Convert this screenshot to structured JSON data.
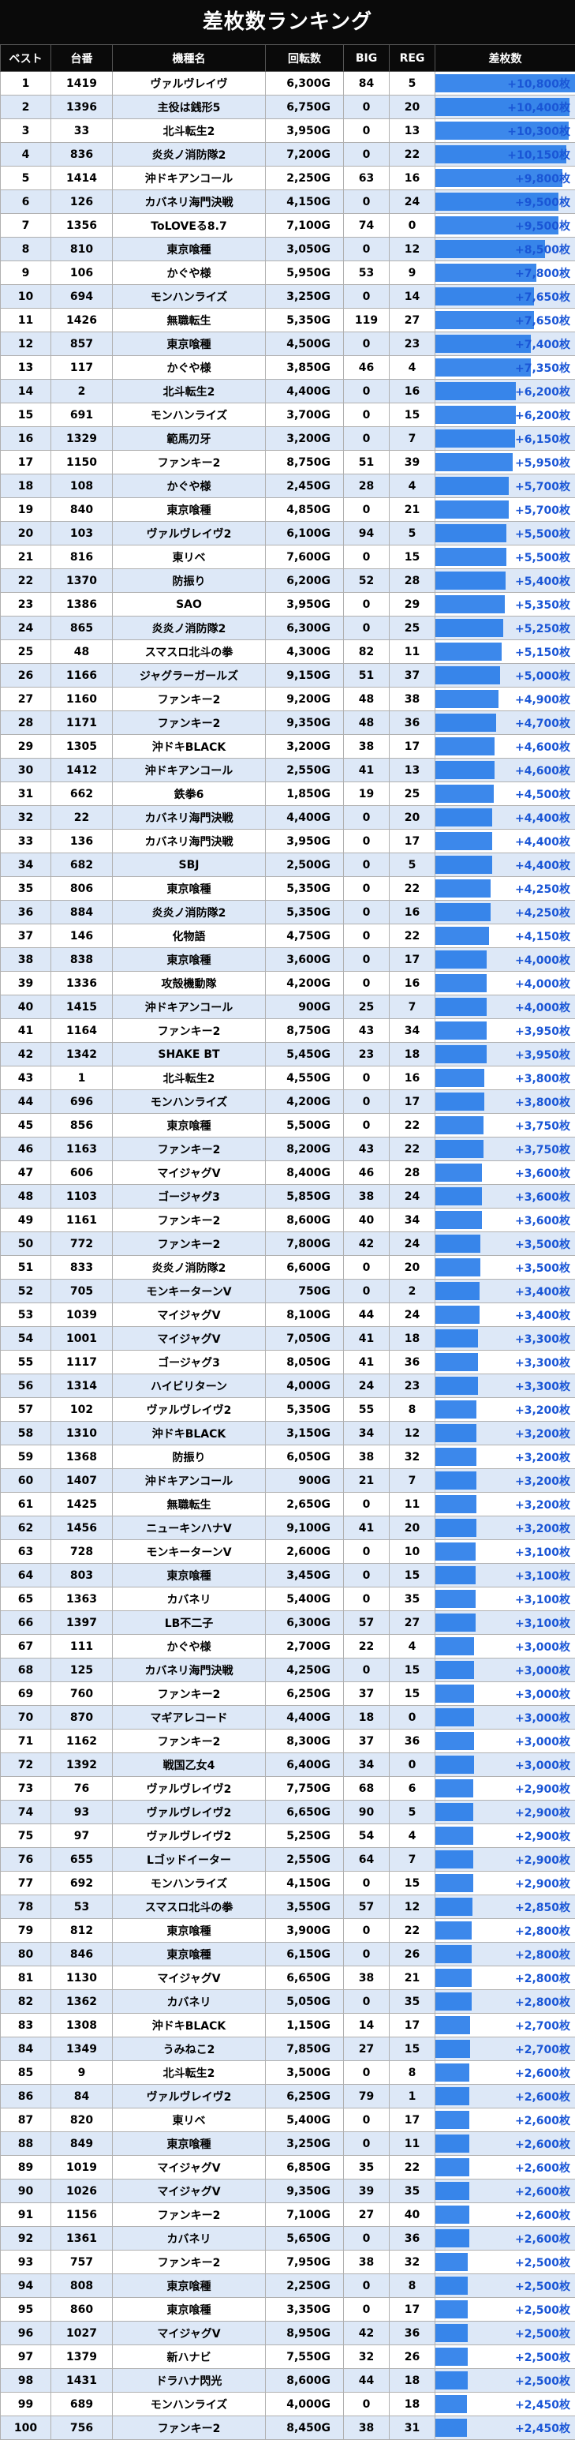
{
  "title": "差枚数ランキング",
  "colors": {
    "header_bg": "#0a0a0a",
    "row_alt": "#dde8f7",
    "diff_text": "#1a56d6",
    "bar": "#1a73e8"
  },
  "headers": [
    "ベスト",
    "台番",
    "機種名",
    "回転数",
    "BIG",
    "REG",
    "差枚数"
  ],
  "rows": [
    {
      "rank": "1",
      "no": "1419",
      "name": "ヴァルヴレイヴ",
      "spins": "6,300G",
      "big": "84",
      "reg": "5",
      "diff": "+10,800枚"
    },
    {
      "rank": "2",
      "no": "1396",
      "name": "主役は銭形5",
      "spins": "6,750G",
      "big": "0",
      "reg": "20",
      "diff": "+10,400枚"
    },
    {
      "rank": "3",
      "no": "33",
      "name": "北斗転生2",
      "spins": "3,950G",
      "big": "0",
      "reg": "13",
      "diff": "+10,300枚"
    },
    {
      "rank": "4",
      "no": "836",
      "name": "炎炎ノ消防隊2",
      "spins": "7,200G",
      "big": "0",
      "reg": "22",
      "diff": "+10,150枚"
    },
    {
      "rank": "5",
      "no": "1414",
      "name": "沖ドキアンコール",
      "spins": "2,250G",
      "big": "63",
      "reg": "16",
      "diff": "+9,800枚"
    },
    {
      "rank": "6",
      "no": "126",
      "name": "カバネリ海門決戦",
      "spins": "4,150G",
      "big": "0",
      "reg": "24",
      "diff": "+9,500枚"
    },
    {
      "rank": "7",
      "no": "1356",
      "name": "ToLOVEる8.7",
      "spins": "7,100G",
      "big": "74",
      "reg": "0",
      "diff": "+9,500枚"
    },
    {
      "rank": "8",
      "no": "810",
      "name": "東京喰種",
      "spins": "3,050G",
      "big": "0",
      "reg": "12",
      "diff": "+8,500枚"
    },
    {
      "rank": "9",
      "no": "106",
      "name": "かぐや様",
      "spins": "5,950G",
      "big": "53",
      "reg": "9",
      "diff": "+7,800枚"
    },
    {
      "rank": "10",
      "no": "694",
      "name": "モンハンライズ",
      "spins": "3,250G",
      "big": "0",
      "reg": "14",
      "diff": "+7,650枚"
    },
    {
      "rank": "11",
      "no": "1426",
      "name": "無職転生",
      "spins": "5,350G",
      "big": "119",
      "reg": "27",
      "diff": "+7,650枚"
    },
    {
      "rank": "12",
      "no": "857",
      "name": "東京喰種",
      "spins": "4,500G",
      "big": "0",
      "reg": "23",
      "diff": "+7,400枚"
    },
    {
      "rank": "13",
      "no": "117",
      "name": "かぐや様",
      "spins": "3,850G",
      "big": "46",
      "reg": "4",
      "diff": "+7,350枚"
    },
    {
      "rank": "14",
      "no": "2",
      "name": "北斗転生2",
      "spins": "4,400G",
      "big": "0",
      "reg": "16",
      "diff": "+6,200枚"
    },
    {
      "rank": "15",
      "no": "691",
      "name": "モンハンライズ",
      "spins": "3,700G",
      "big": "0",
      "reg": "15",
      "diff": "+6,200枚"
    },
    {
      "rank": "16",
      "no": "1329",
      "name": "範馬刃牙",
      "spins": "3,200G",
      "big": "0",
      "reg": "7",
      "diff": "+6,150枚"
    },
    {
      "rank": "17",
      "no": "1150",
      "name": "ファンキー2",
      "spins": "8,750G",
      "big": "51",
      "reg": "39",
      "diff": "+5,950枚"
    },
    {
      "rank": "18",
      "no": "108",
      "name": "かぐや様",
      "spins": "2,450G",
      "big": "28",
      "reg": "4",
      "diff": "+5,700枚"
    },
    {
      "rank": "19",
      "no": "840",
      "name": "東京喰種",
      "spins": "4,850G",
      "big": "0",
      "reg": "21",
      "diff": "+5,700枚"
    },
    {
      "rank": "20",
      "no": "103",
      "name": "ヴァルヴレイヴ2",
      "spins": "6,100G",
      "big": "94",
      "reg": "5",
      "diff": "+5,500枚"
    },
    {
      "rank": "21",
      "no": "816",
      "name": "東リベ",
      "spins": "7,600G",
      "big": "0",
      "reg": "15",
      "diff": "+5,500枚"
    },
    {
      "rank": "22",
      "no": "1370",
      "name": "防振り",
      "spins": "6,200G",
      "big": "52",
      "reg": "28",
      "diff": "+5,400枚"
    },
    {
      "rank": "23",
      "no": "1386",
      "name": "SAO",
      "spins": "3,950G",
      "big": "0",
      "reg": "29",
      "diff": "+5,350枚"
    },
    {
      "rank": "24",
      "no": "865",
      "name": "炎炎ノ消防隊2",
      "spins": "6,300G",
      "big": "0",
      "reg": "25",
      "diff": "+5,250枚"
    },
    {
      "rank": "25",
      "no": "48",
      "name": "スマスロ北斗の拳",
      "spins": "4,300G",
      "big": "82",
      "reg": "11",
      "diff": "+5,150枚"
    },
    {
      "rank": "26",
      "no": "1166",
      "name": "ジャグラーガールズ",
      "spins": "9,150G",
      "big": "51",
      "reg": "37",
      "diff": "+5,000枚"
    },
    {
      "rank": "27",
      "no": "1160",
      "name": "ファンキー2",
      "spins": "9,200G",
      "big": "48",
      "reg": "38",
      "diff": "+4,900枚"
    },
    {
      "rank": "28",
      "no": "1171",
      "name": "ファンキー2",
      "spins": "9,350G",
      "big": "48",
      "reg": "36",
      "diff": "+4,700枚"
    },
    {
      "rank": "29",
      "no": "1305",
      "name": "沖ドキBLACK",
      "spins": "3,200G",
      "big": "38",
      "reg": "17",
      "diff": "+4,600枚"
    },
    {
      "rank": "30",
      "no": "1412",
      "name": "沖ドキアンコール",
      "spins": "2,550G",
      "big": "41",
      "reg": "13",
      "diff": "+4,600枚"
    },
    {
      "rank": "31",
      "no": "662",
      "name": "鉄拳6",
      "spins": "1,850G",
      "big": "19",
      "reg": "25",
      "diff": "+4,500枚"
    },
    {
      "rank": "32",
      "no": "22",
      "name": "カバネリ海門決戦",
      "spins": "4,400G",
      "big": "0",
      "reg": "20",
      "diff": "+4,400枚"
    },
    {
      "rank": "33",
      "no": "136",
      "name": "カバネリ海門決戦",
      "spins": "3,950G",
      "big": "0",
      "reg": "17",
      "diff": "+4,400枚"
    },
    {
      "rank": "34",
      "no": "682",
      "name": "SBJ",
      "spins": "2,500G",
      "big": "0",
      "reg": "5",
      "diff": "+4,400枚"
    },
    {
      "rank": "35",
      "no": "806",
      "name": "東京喰種",
      "spins": "5,350G",
      "big": "0",
      "reg": "22",
      "diff": "+4,250枚"
    },
    {
      "rank": "36",
      "no": "884",
      "name": "炎炎ノ消防隊2",
      "spins": "5,350G",
      "big": "0",
      "reg": "16",
      "diff": "+4,250枚"
    },
    {
      "rank": "37",
      "no": "146",
      "name": "化物語",
      "spins": "4,750G",
      "big": "0",
      "reg": "22",
      "diff": "+4,150枚"
    },
    {
      "rank": "38",
      "no": "838",
      "name": "東京喰種",
      "spins": "3,600G",
      "big": "0",
      "reg": "17",
      "diff": "+4,000枚"
    },
    {
      "rank": "39",
      "no": "1336",
      "name": "攻殻機動隊",
      "spins": "4,200G",
      "big": "0",
      "reg": "16",
      "diff": "+4,000枚"
    },
    {
      "rank": "40",
      "no": "1415",
      "name": "沖ドキアンコール",
      "spins": "900G",
      "big": "25",
      "reg": "7",
      "diff": "+4,000枚"
    },
    {
      "rank": "41",
      "no": "1164",
      "name": "ファンキー2",
      "spins": "8,750G",
      "big": "43",
      "reg": "34",
      "diff": "+3,950枚"
    },
    {
      "rank": "42",
      "no": "1342",
      "name": "SHAKE BT",
      "spins": "5,450G",
      "big": "23",
      "reg": "18",
      "diff": "+3,950枚"
    },
    {
      "rank": "43",
      "no": "1",
      "name": "北斗転生2",
      "spins": "4,550G",
      "big": "0",
      "reg": "16",
      "diff": "+3,800枚"
    },
    {
      "rank": "44",
      "no": "696",
      "name": "モンハンライズ",
      "spins": "4,200G",
      "big": "0",
      "reg": "17",
      "diff": "+3,800枚"
    },
    {
      "rank": "45",
      "no": "856",
      "name": "東京喰種",
      "spins": "5,500G",
      "big": "0",
      "reg": "22",
      "diff": "+3,750枚"
    },
    {
      "rank": "46",
      "no": "1163",
      "name": "ファンキー2",
      "spins": "8,200G",
      "big": "43",
      "reg": "22",
      "diff": "+3,750枚"
    },
    {
      "rank": "47",
      "no": "606",
      "name": "マイジャグV",
      "spins": "8,400G",
      "big": "46",
      "reg": "28",
      "diff": "+3,600枚"
    },
    {
      "rank": "48",
      "no": "1103",
      "name": "ゴージャグ3",
      "spins": "5,850G",
      "big": "38",
      "reg": "24",
      "diff": "+3,600枚"
    },
    {
      "rank": "49",
      "no": "1161",
      "name": "ファンキー2",
      "spins": "8,600G",
      "big": "40",
      "reg": "34",
      "diff": "+3,600枚"
    },
    {
      "rank": "50",
      "no": "772",
      "name": "ファンキー2",
      "spins": "7,800G",
      "big": "42",
      "reg": "24",
      "diff": "+3,500枚"
    },
    {
      "rank": "51",
      "no": "833",
      "name": "炎炎ノ消防隊2",
      "spins": "6,600G",
      "big": "0",
      "reg": "20",
      "diff": "+3,500枚"
    },
    {
      "rank": "52",
      "no": "705",
      "name": "モンキーターンV",
      "spins": "750G",
      "big": "0",
      "reg": "2",
      "diff": "+3,400枚"
    },
    {
      "rank": "53",
      "no": "1039",
      "name": "マイジャグV",
      "spins": "8,100G",
      "big": "44",
      "reg": "24",
      "diff": "+3,400枚"
    },
    {
      "rank": "54",
      "no": "1001",
      "name": "マイジャグV",
      "spins": "7,050G",
      "big": "41",
      "reg": "18",
      "diff": "+3,300枚"
    },
    {
      "rank": "55",
      "no": "1117",
      "name": "ゴージャグ3",
      "spins": "8,050G",
      "big": "41",
      "reg": "36",
      "diff": "+3,300枚"
    },
    {
      "rank": "56",
      "no": "1314",
      "name": "ハイビリターン",
      "spins": "4,000G",
      "big": "24",
      "reg": "23",
      "diff": "+3,300枚"
    },
    {
      "rank": "57",
      "no": "102",
      "name": "ヴァルヴレイヴ2",
      "spins": "5,350G",
      "big": "55",
      "reg": "8",
      "diff": "+3,200枚"
    },
    {
      "rank": "58",
      "no": "1310",
      "name": "沖ドキBLACK",
      "spins": "3,150G",
      "big": "34",
      "reg": "12",
      "diff": "+3,200枚"
    },
    {
      "rank": "59",
      "no": "1368",
      "name": "防振り",
      "spins": "6,050G",
      "big": "38",
      "reg": "32",
      "diff": "+3,200枚"
    },
    {
      "rank": "60",
      "no": "1407",
      "name": "沖ドキアンコール",
      "spins": "900G",
      "big": "21",
      "reg": "7",
      "diff": "+3,200枚"
    },
    {
      "rank": "61",
      "no": "1425",
      "name": "無職転生",
      "spins": "2,650G",
      "big": "0",
      "reg": "11",
      "diff": "+3,200枚"
    },
    {
      "rank": "62",
      "no": "1456",
      "name": "ニューキンハナV",
      "spins": "9,100G",
      "big": "41",
      "reg": "20",
      "diff": "+3,200枚"
    },
    {
      "rank": "63",
      "no": "728",
      "name": "モンキーターンV",
      "spins": "2,600G",
      "big": "0",
      "reg": "10",
      "diff": "+3,100枚"
    },
    {
      "rank": "64",
      "no": "803",
      "name": "東京喰種",
      "spins": "3,450G",
      "big": "0",
      "reg": "15",
      "diff": "+3,100枚"
    },
    {
      "rank": "65",
      "no": "1363",
      "name": "カバネリ",
      "spins": "5,400G",
      "big": "0",
      "reg": "35",
      "diff": "+3,100枚"
    },
    {
      "rank": "66",
      "no": "1397",
      "name": "LB不二子",
      "spins": "6,300G",
      "big": "57",
      "reg": "27",
      "diff": "+3,100枚"
    },
    {
      "rank": "67",
      "no": "111",
      "name": "かぐや様",
      "spins": "2,700G",
      "big": "22",
      "reg": "4",
      "diff": "+3,000枚"
    },
    {
      "rank": "68",
      "no": "125",
      "name": "カバネリ海門決戦",
      "spins": "4,250G",
      "big": "0",
      "reg": "15",
      "diff": "+3,000枚"
    },
    {
      "rank": "69",
      "no": "760",
      "name": "ファンキー2",
      "spins": "6,250G",
      "big": "37",
      "reg": "15",
      "diff": "+3,000枚"
    },
    {
      "rank": "70",
      "no": "870",
      "name": "マギアレコード",
      "spins": "4,400G",
      "big": "18",
      "reg": "0",
      "diff": "+3,000枚"
    },
    {
      "rank": "71",
      "no": "1162",
      "name": "ファンキー2",
      "spins": "8,300G",
      "big": "37",
      "reg": "36",
      "diff": "+3,000枚"
    },
    {
      "rank": "72",
      "no": "1392",
      "name": "戦国乙女4",
      "spins": "6,400G",
      "big": "34",
      "reg": "0",
      "diff": "+3,000枚"
    },
    {
      "rank": "73",
      "no": "76",
      "name": "ヴァルヴレイヴ2",
      "spins": "7,750G",
      "big": "68",
      "reg": "6",
      "diff": "+2,900枚"
    },
    {
      "rank": "74",
      "no": "93",
      "name": "ヴァルヴレイヴ2",
      "spins": "6,650G",
      "big": "90",
      "reg": "5",
      "diff": "+2,900枚"
    },
    {
      "rank": "75",
      "no": "97",
      "name": "ヴァルヴレイヴ2",
      "spins": "5,250G",
      "big": "54",
      "reg": "4",
      "diff": "+2,900枚"
    },
    {
      "rank": "76",
      "no": "655",
      "name": "Lゴッドイーター",
      "spins": "2,550G",
      "big": "64",
      "reg": "7",
      "diff": "+2,900枚"
    },
    {
      "rank": "77",
      "no": "692",
      "name": "モンハンライズ",
      "spins": "4,150G",
      "big": "0",
      "reg": "15",
      "diff": "+2,900枚"
    },
    {
      "rank": "78",
      "no": "53",
      "name": "スマスロ北斗の拳",
      "spins": "3,550G",
      "big": "57",
      "reg": "12",
      "diff": "+2,850枚"
    },
    {
      "rank": "79",
      "no": "812",
      "name": "東京喰種",
      "spins": "3,900G",
      "big": "0",
      "reg": "22",
      "diff": "+2,800枚"
    },
    {
      "rank": "80",
      "no": "846",
      "name": "東京喰種",
      "spins": "6,150G",
      "big": "0",
      "reg": "26",
      "diff": "+2,800枚"
    },
    {
      "rank": "81",
      "no": "1130",
      "name": "マイジャグV",
      "spins": "6,650G",
      "big": "38",
      "reg": "21",
      "diff": "+2,800枚"
    },
    {
      "rank": "82",
      "no": "1362",
      "name": "カバネリ",
      "spins": "5,050G",
      "big": "0",
      "reg": "35",
      "diff": "+2,800枚"
    },
    {
      "rank": "83",
      "no": "1308",
      "name": "沖ドキBLACK",
      "spins": "1,150G",
      "big": "14",
      "reg": "17",
      "diff": "+2,700枚"
    },
    {
      "rank": "84",
      "no": "1349",
      "name": "うみねこ2",
      "spins": "7,850G",
      "big": "27",
      "reg": "15",
      "diff": "+2,700枚"
    },
    {
      "rank": "85",
      "no": "9",
      "name": "北斗転生2",
      "spins": "3,500G",
      "big": "0",
      "reg": "8",
      "diff": "+2,600枚"
    },
    {
      "rank": "86",
      "no": "84",
      "name": "ヴァルヴレイヴ2",
      "spins": "6,250G",
      "big": "79",
      "reg": "1",
      "diff": "+2,600枚"
    },
    {
      "rank": "87",
      "no": "820",
      "name": "東リベ",
      "spins": "5,400G",
      "big": "0",
      "reg": "17",
      "diff": "+2,600枚"
    },
    {
      "rank": "88",
      "no": "849",
      "name": "東京喰種",
      "spins": "3,250G",
      "big": "0",
      "reg": "11",
      "diff": "+2,600枚"
    },
    {
      "rank": "89",
      "no": "1019",
      "name": "マイジャグV",
      "spins": "6,850G",
      "big": "35",
      "reg": "22",
      "diff": "+2,600枚"
    },
    {
      "rank": "90",
      "no": "1026",
      "name": "マイジャグV",
      "spins": "9,350G",
      "big": "39",
      "reg": "35",
      "diff": "+2,600枚"
    },
    {
      "rank": "91",
      "no": "1156",
      "name": "ファンキー2",
      "spins": "7,100G",
      "big": "27",
      "reg": "40",
      "diff": "+2,600枚"
    },
    {
      "rank": "92",
      "no": "1361",
      "name": "カバネリ",
      "spins": "5,650G",
      "big": "0",
      "reg": "36",
      "diff": "+2,600枚"
    },
    {
      "rank": "93",
      "no": "757",
      "name": "ファンキー2",
      "spins": "7,950G",
      "big": "38",
      "reg": "32",
      "diff": "+2,500枚"
    },
    {
      "rank": "94",
      "no": "808",
      "name": "東京喰種",
      "spins": "2,250G",
      "big": "0",
      "reg": "8",
      "diff": "+2,500枚"
    },
    {
      "rank": "95",
      "no": "860",
      "name": "東京喰種",
      "spins": "3,350G",
      "big": "0",
      "reg": "17",
      "diff": "+2,500枚"
    },
    {
      "rank": "96",
      "no": "1027",
      "name": "マイジャグV",
      "spins": "8,950G",
      "big": "42",
      "reg": "36",
      "diff": "+2,500枚"
    },
    {
      "rank": "97",
      "no": "1379",
      "name": "新ハナビ",
      "spins": "7,550G",
      "big": "32",
      "reg": "26",
      "diff": "+2,500枚"
    },
    {
      "rank": "98",
      "no": "1431",
      "name": "ドラハナ閃光",
      "spins": "8,600G",
      "big": "44",
      "reg": "18",
      "diff": "+2,500枚"
    },
    {
      "rank": "99",
      "no": "689",
      "name": "モンハンライズ",
      "spins": "4,000G",
      "big": "0",
      "reg": "18",
      "diff": "+2,450枚"
    },
    {
      "rank": "100",
      "no": "756",
      "name": "ファンキー2",
      "spins": "8,450G",
      "big": "38",
      "reg": "31",
      "diff": "+2,450枚"
    }
  ]
}
